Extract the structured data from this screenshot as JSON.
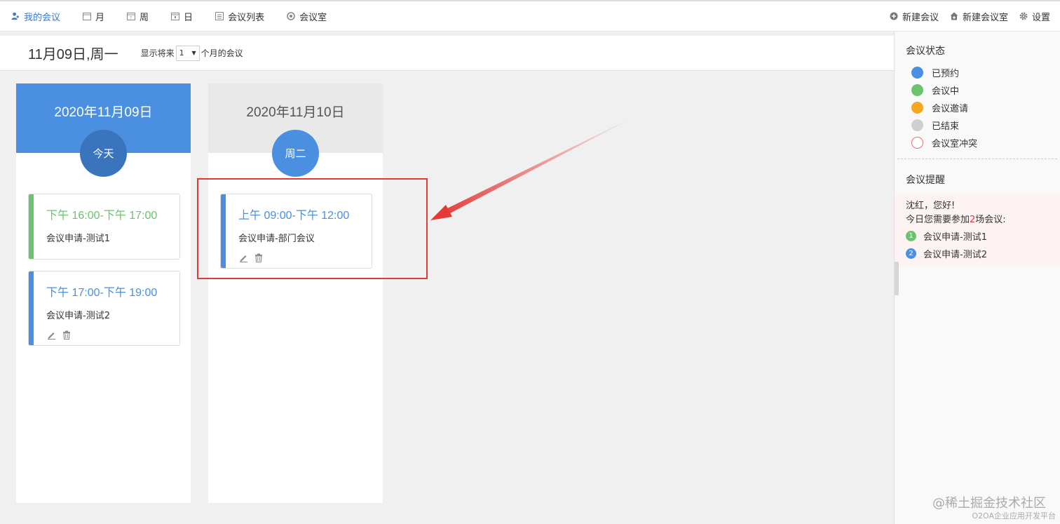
{
  "nav": {
    "left": [
      {
        "label": "我的会议",
        "icon": "user-icon",
        "active": true
      },
      {
        "label": "月",
        "icon": "calendar-month-icon"
      },
      {
        "label": "周",
        "icon": "calendar-week-icon"
      },
      {
        "label": "日",
        "icon": "calendar-day-icon"
      },
      {
        "label": "会议列表",
        "icon": "list-icon"
      },
      {
        "label": "会议室",
        "icon": "room-icon"
      }
    ],
    "right": [
      {
        "label": "新建会议",
        "icon": "plus-circle-icon"
      },
      {
        "label": "新建会议室",
        "icon": "home-plus-icon"
      },
      {
        "label": "设置",
        "icon": "gear-icon"
      }
    ]
  },
  "subheader": {
    "current_date": "11月09日,周一",
    "range_prefix": "显示将来",
    "range_value": "1",
    "range_suffix": "个月的会议"
  },
  "days": [
    {
      "date": "2020年11月09日",
      "badge": "今天",
      "meetings": [
        {
          "time": "下午 16:00-下午 17:00",
          "title": "会议申请-测试1",
          "status": "in-progress",
          "color": "#6cc36f",
          "editable": false
        },
        {
          "time": "下午 17:00-下午 19:00",
          "title": "会议申请-测试2",
          "status": "booked",
          "color": "#4a8fe0",
          "editable": true
        }
      ]
    },
    {
      "date": "2020年11月10日",
      "badge": "周二",
      "meetings": [
        {
          "time": "上午 09:00-下午 12:00",
          "title": "会议申请-部门会议",
          "status": "booked",
          "color": "#4a8fe0",
          "editable": true
        }
      ]
    }
  ],
  "status_panel": {
    "title": "会议状态",
    "items": [
      {
        "label": "已预约",
        "color": "#4a8fe0",
        "style": "filled"
      },
      {
        "label": "会议中",
        "color": "#6cc36f",
        "style": "filled"
      },
      {
        "label": "会议邀请",
        "color": "#f5a623",
        "style": "filled"
      },
      {
        "label": "已结束",
        "color": "#cfcfcf",
        "style": "filled"
      },
      {
        "label": "会议室冲突",
        "color": "#e57373",
        "style": "outline"
      }
    ]
  },
  "reminder_panel": {
    "title": "会议提醒",
    "greeting": "沈红，您好!",
    "line_prefix": "今日您需要参加",
    "count": "2",
    "line_suffix": "场会议:",
    "items": [
      {
        "num": "1",
        "label": "会议申请-测试1",
        "color": "#6cc36f"
      },
      {
        "num": "2",
        "label": "会议申请-测试2",
        "color": "#4a8fe0"
      }
    ]
  },
  "watermark": {
    "main": "@稀土掘金技术社区",
    "sub": "O2OA企业应用开发平台"
  }
}
